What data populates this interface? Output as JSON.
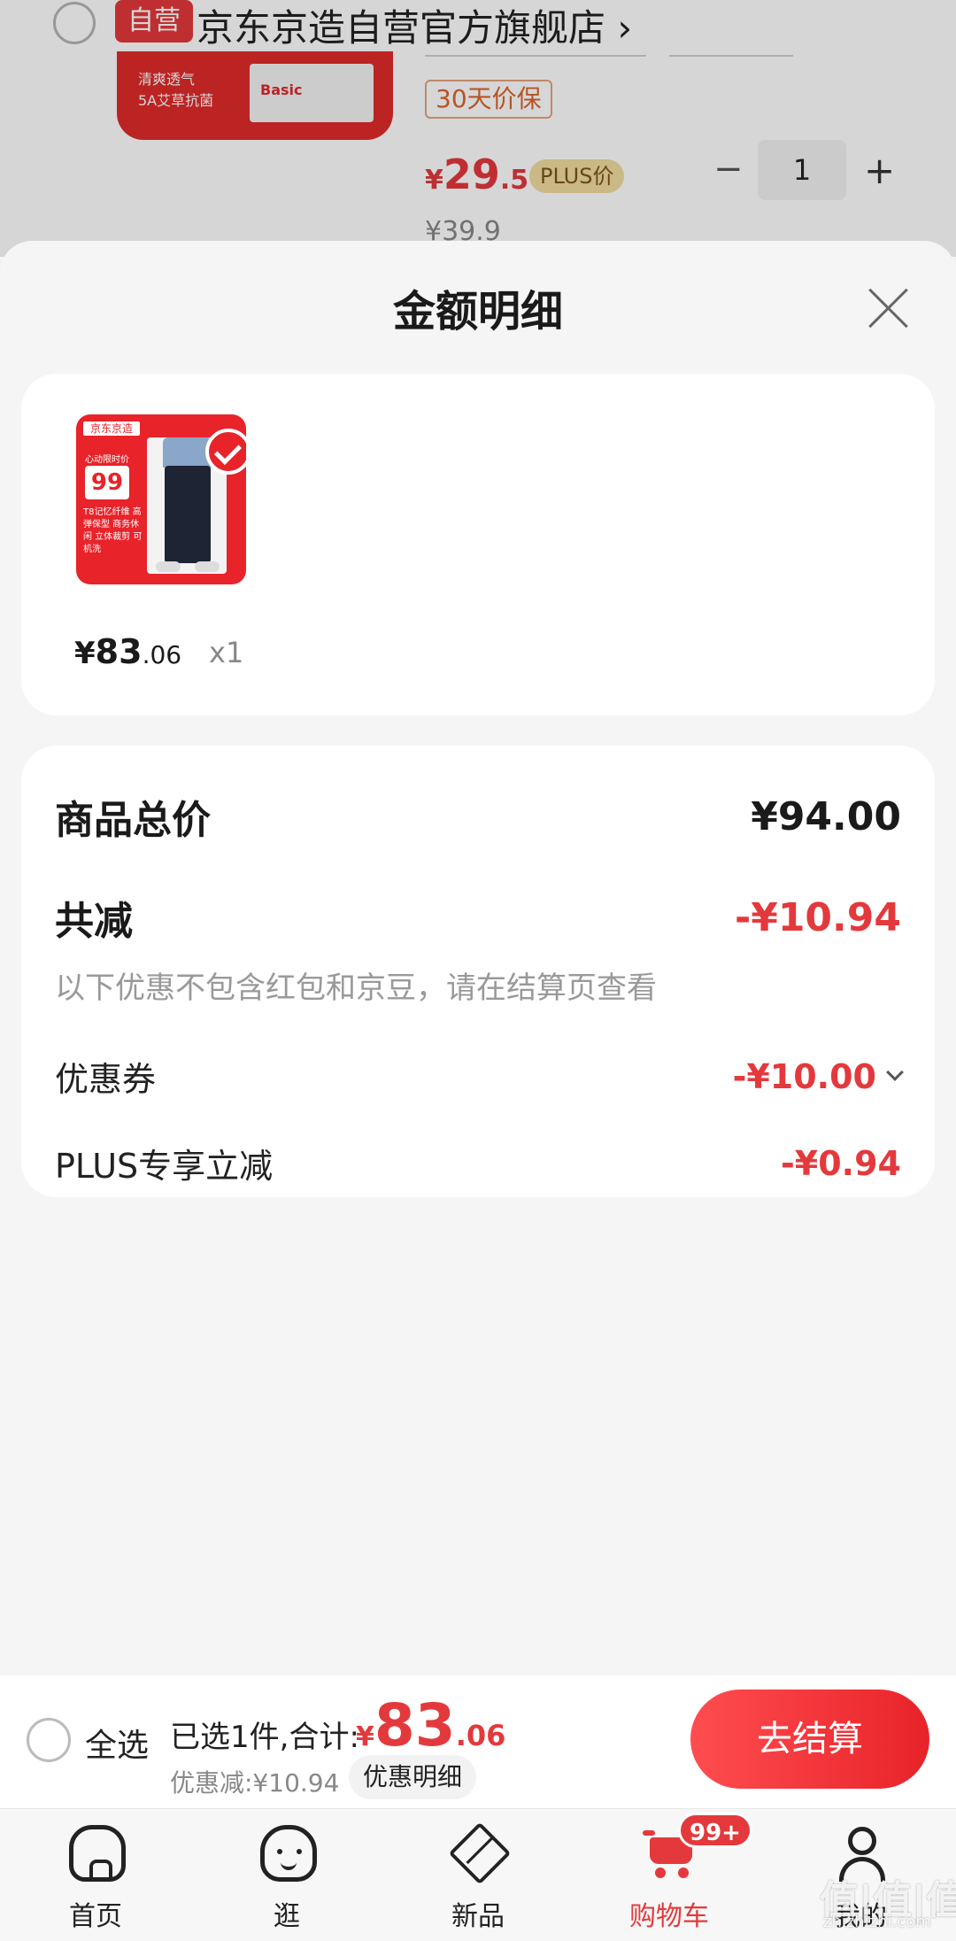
{
  "background_cart": {
    "self_tag": "自营",
    "store_name": "京东京造自营官方旗舰店 ›",
    "thumb_text_1": "清爽透气",
    "thumb_text_2": "5A艾草抗菌",
    "thumb_card_text": "Basic",
    "price_guard": "30天价保",
    "price_currency": "¥",
    "price_int": "29",
    "price_dec": ".5",
    "plus_tag": "PLUS价",
    "minus": "−",
    "quantity": "1",
    "plus": "+",
    "original_price": "¥39.9"
  },
  "sheet": {
    "title": "金额明细",
    "product": {
      "image_brand": "京东京造",
      "image_sub": "心动限时价",
      "image_badge": "99",
      "image_desc": "T8记忆纤维 高弹保型 商务休闲 立体裁剪 可机洗",
      "price_currency": "¥",
      "price_int": "83",
      "price_dec": ".06",
      "quantity": "x1"
    },
    "detail": {
      "total_label": "商品总价",
      "total_value": "¥94.00",
      "reduce_label": "共减",
      "reduce_value": "-¥10.94",
      "reduce_note": "以下优惠不包含红包和京豆，请在结算页查看",
      "coupon_label": "优惠券",
      "coupon_value": "-¥10.00",
      "plus_label": "PLUS专享立减",
      "plus_value": "-¥0.94"
    }
  },
  "checkout": {
    "select_all": "全选",
    "selected_text": "已选1件,合计:",
    "total_currency": "¥",
    "total_int": "83",
    "total_dec": ".06",
    "discount_text": "优惠减:¥10.94",
    "discount_detail_button": "优惠明细",
    "checkout_button": "去结算"
  },
  "tabbar": {
    "tabs": [
      {
        "label": "首页",
        "icon": "home-icon"
      },
      {
        "label": "逛",
        "icon": "browse-icon"
      },
      {
        "label": "新品",
        "icon": "box-icon"
      },
      {
        "label": "购物车",
        "icon": "cart-icon"
      },
      {
        "label": "我的",
        "icon": "user-icon"
      }
    ],
    "cart_badge": "99+",
    "active_color": "#e4393c"
  },
  "watermark": {
    "text": "值|值|值",
    "sub": "zhizhizhi.com"
  }
}
